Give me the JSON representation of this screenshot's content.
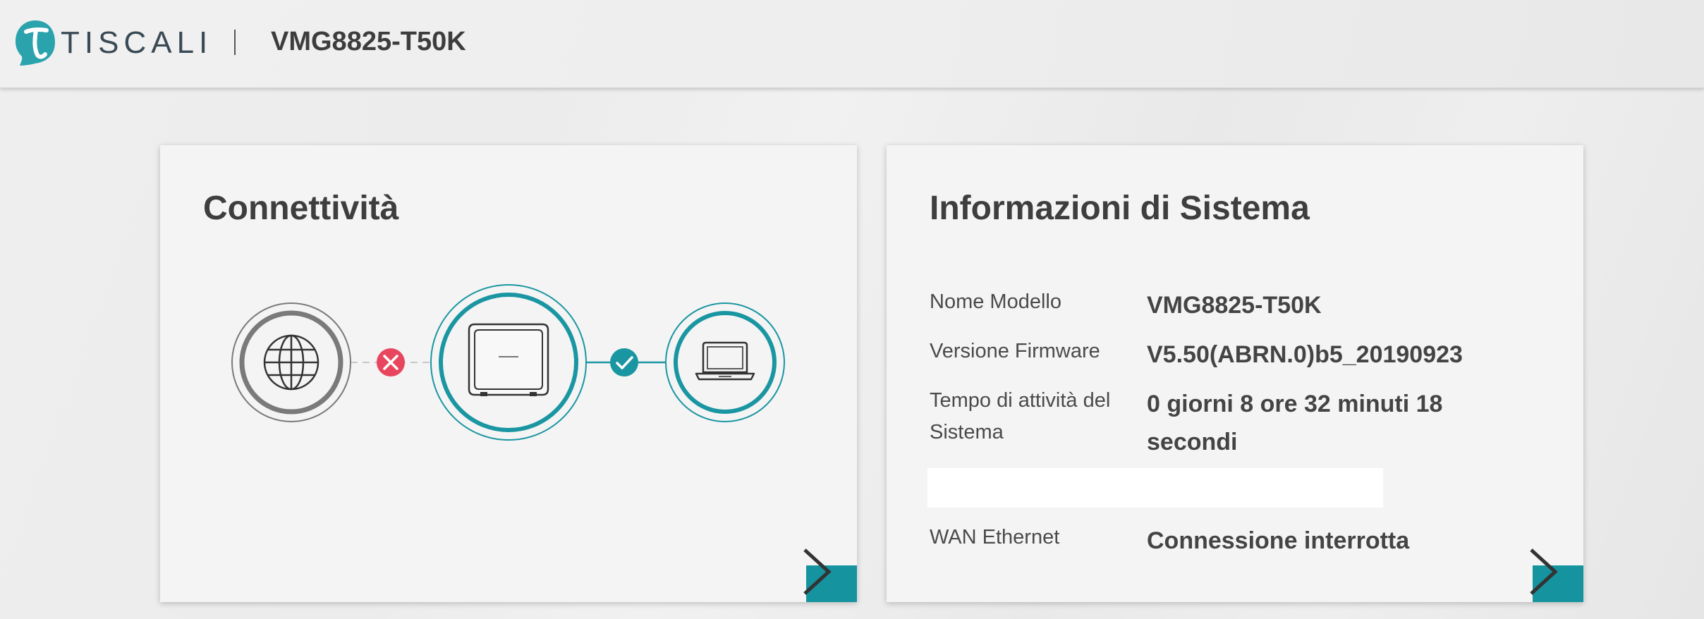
{
  "header": {
    "brand": "TISCALI",
    "device_model": "VMG8825-T50K"
  },
  "connectivity": {
    "title": "Connettività",
    "internet_status": "disconnected",
    "lan_status": "connected",
    "error_color": "#e8465f",
    "ok_color": "#1a96a2"
  },
  "system_info": {
    "title": "Informazioni di Sistema",
    "rows": [
      {
        "label": "Nome Modello",
        "value": "VMG8825-T50K"
      },
      {
        "label": "Versione Firmware",
        "value": "V5.50(ABRN.0)b5_20190923"
      },
      {
        "label": "Tempo di attività del Sistema",
        "value": "0 giorni 8 ore 32 minuti 18 secondi"
      },
      {
        "label": "WAN Ethernet",
        "value": "Connessione interrotta"
      }
    ]
  },
  "colors": {
    "accent": "#15939f",
    "brand_teal": "#2aa3ad",
    "text_dark": "#3e3e3e"
  },
  "icons": {
    "logo": "tiscali-logo-icon",
    "internet": "globe-icon",
    "router": "router-icon",
    "client": "laptop-icon",
    "error": "x-circle-icon",
    "ok": "check-circle-icon",
    "more": "chevron-right-icon"
  }
}
